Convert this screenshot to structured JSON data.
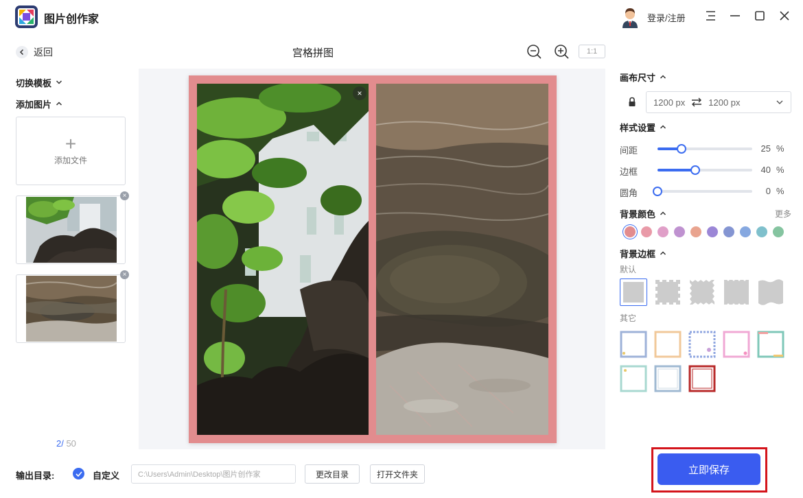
{
  "app": {
    "title": "图片创作家",
    "login": "登录/注册"
  },
  "toolbar": {
    "back": "返回",
    "page_title": "宫格拼图",
    "ratio": "1:1"
  },
  "left_panel": {
    "switch_template": "切换模板",
    "add_images": "添加图片",
    "add_file": "添加文件",
    "counter_current": "2/",
    "counter_total": " 50",
    "thumbnails": [
      {
        "name": "plant-leaves-photo"
      },
      {
        "name": "stream-rocks-photo"
      }
    ]
  },
  "right_panel": {
    "canvas_size": {
      "title": "画布尺寸",
      "width": "1200 px",
      "height": "1200 px",
      "locked": true
    },
    "style_settings": {
      "title": "样式设置",
      "sliders": [
        {
          "label": "间距",
          "value": 25,
          "unit": "%"
        },
        {
          "label": "边框",
          "value": 40,
          "unit": "%"
        },
        {
          "label": "圆角",
          "value": 0,
          "unit": "%"
        }
      ]
    },
    "bg_color": {
      "title": "背景颜色",
      "more": "更多",
      "selected_index": 0,
      "swatches": [
        "#e28c8e",
        "#e99aa8",
        "#e09fc8",
        "#bf92d0",
        "#e9a48f",
        "#9b86d6",
        "#8495d2",
        "#86a8e0",
        "#7fc0cc",
        "#85c4a0"
      ]
    },
    "bg_border": {
      "title": "背景边框",
      "default_label": "默认",
      "other_label": "其它"
    }
  },
  "footer": {
    "output_label": "输出目录:",
    "custom_label": "自定义",
    "path": "C:\\Users\\Admin\\Desktop\\图片创作家",
    "change_dir": "更改目录",
    "open_folder": "打开文件夹",
    "save": "立即保存"
  },
  "colors": {
    "accent": "#3b6cf0",
    "frame": "#e28c8e",
    "save_button": "#3a5cf0",
    "highlight": "#d4141b"
  }
}
